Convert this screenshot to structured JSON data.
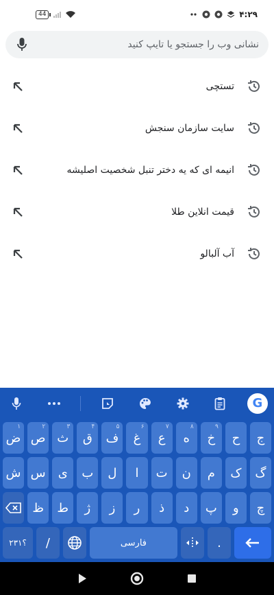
{
  "status_bar": {
    "battery": "44",
    "time": "۴:۲۹"
  },
  "search": {
    "placeholder": "نشانی وب را جستجو یا تایپ کنید"
  },
  "suggestions": [
    {
      "text": "تستچی"
    },
    {
      "text": "سایت سازمان سنجش"
    },
    {
      "text": "انیمه ای که یه دختر تنبل شخصیت اصلیشه"
    },
    {
      "text": "قیمت انلاین طلا"
    },
    {
      "text": "آب آلبالو"
    }
  ],
  "keyboard": {
    "row1": [
      {
        "k": "ج",
        "s": ""
      },
      {
        "k": "ح",
        "s": ""
      },
      {
        "k": "خ",
        "s": "۹"
      },
      {
        "k": "ه",
        "s": "۸"
      },
      {
        "k": "ع",
        "s": "۷"
      },
      {
        "k": "غ",
        "s": "۶"
      },
      {
        "k": "ف",
        "s": "۵"
      },
      {
        "k": "ق",
        "s": "۴"
      },
      {
        "k": "ث",
        "s": "۳"
      },
      {
        "k": "ص",
        "s": "۲"
      },
      {
        "k": "ض",
        "s": "۱"
      }
    ],
    "row2": [
      "گ",
      "ک",
      "م",
      "ن",
      "ت",
      "ا",
      "ل",
      "ب",
      "ی",
      "س",
      "ش"
    ],
    "row3": [
      "چ",
      "و",
      "پ",
      "د",
      "ذ",
      "ر",
      "ز",
      "ژ",
      "ط",
      "ظ"
    ],
    "numbers_label": "۲۳۱؟",
    "slash_label": "/",
    "space_label": "فارسی",
    "period_label": ".",
    "google_label": "G"
  },
  "colors": {
    "keyboard_bg": "#1a56b8",
    "key_bg": "#4279d1",
    "enter_bg": "#2e6ee8"
  }
}
